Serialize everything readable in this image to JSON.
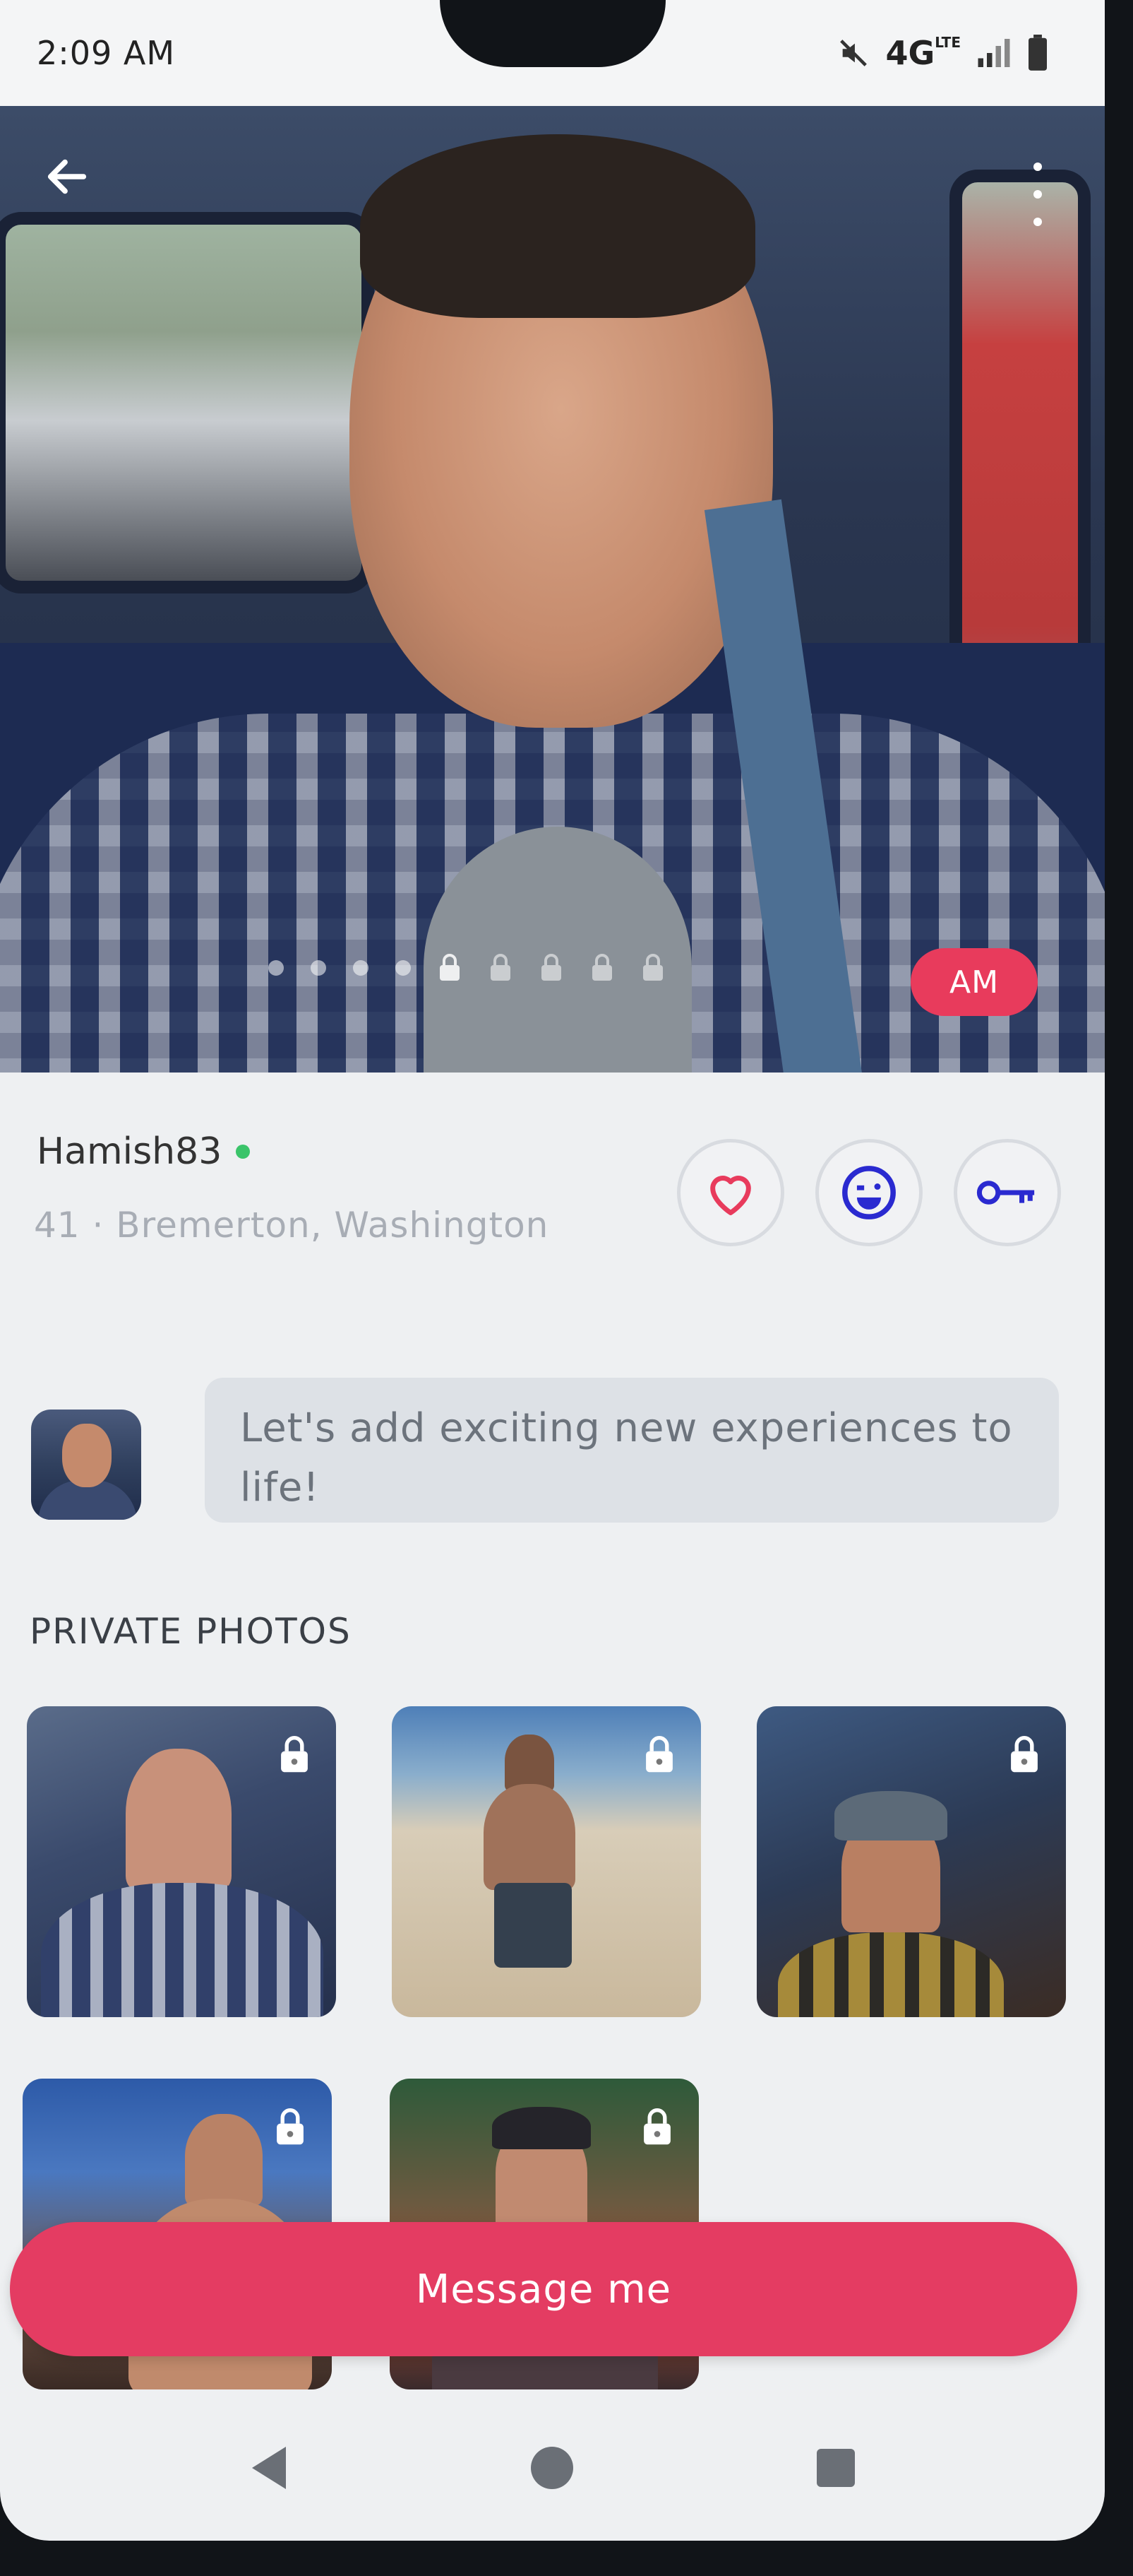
{
  "status_bar": {
    "time": "2:09 AM",
    "network": "4G",
    "network_sub": "LTE"
  },
  "hero": {
    "badge": "AM",
    "pager_dots": 4,
    "pager_locks": 5
  },
  "profile": {
    "username": "Hamish83",
    "meta": "41 · Bremerton, Washington",
    "online": true
  },
  "actions": {
    "like_icon": "heart-icon",
    "wink_icon": "wink-face-icon",
    "key_icon": "key-icon"
  },
  "about": {
    "text": "Let's add exciting new experiences to life!"
  },
  "private_photos": {
    "title": "PRIVATE PHOTOS",
    "count": 5
  },
  "message_button": {
    "label": "Message me"
  },
  "colors": {
    "accent": "#e43c62",
    "online": "#3ac46a",
    "key_blue": "#2a2ad0"
  }
}
